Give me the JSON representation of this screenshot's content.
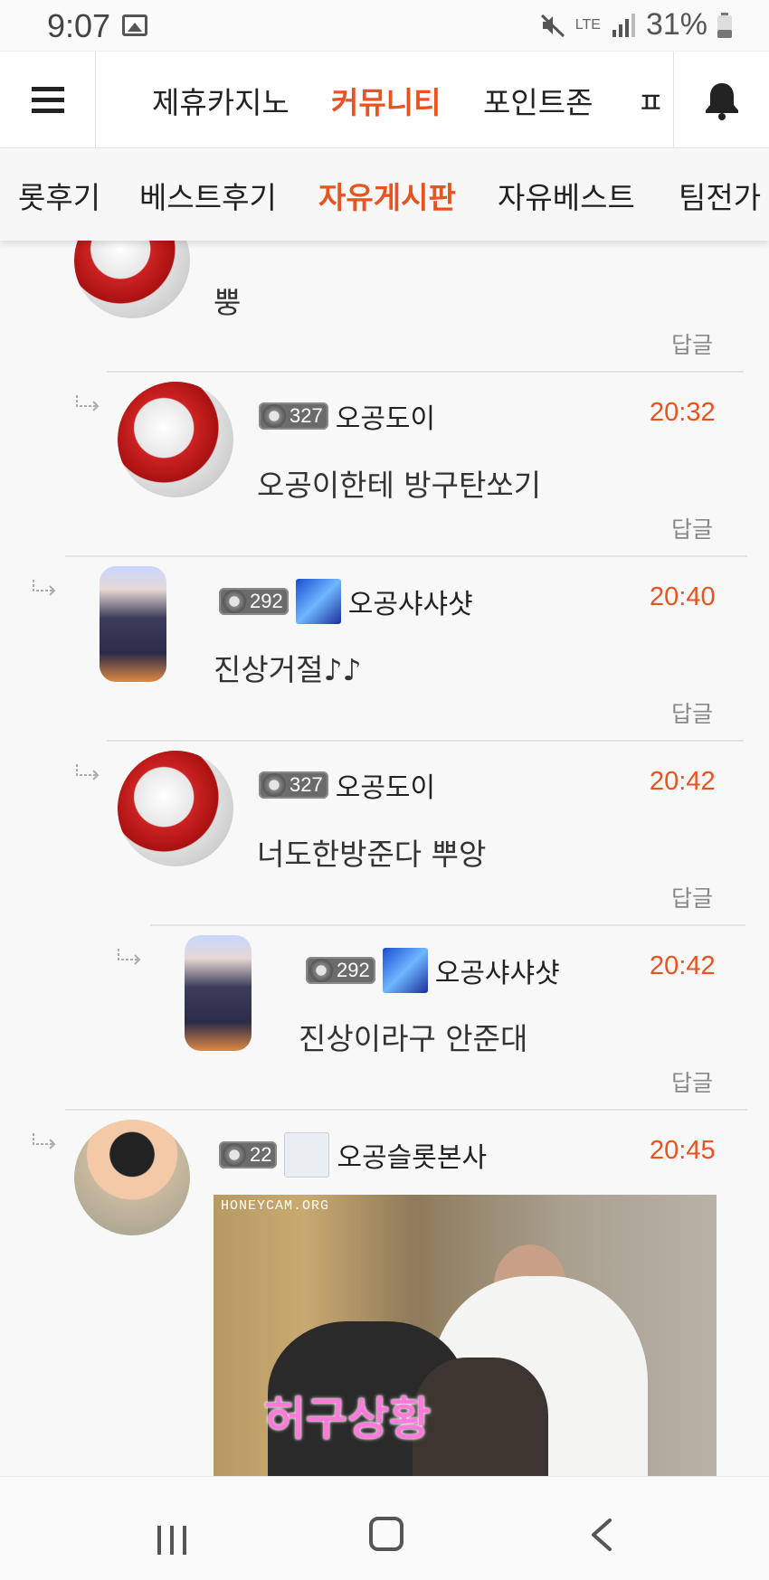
{
  "status_bar": {
    "time": "9:07",
    "network": "LTE",
    "battery_pct": "31%"
  },
  "main_nav": {
    "tabs": [
      {
        "label": "제휴카지노"
      },
      {
        "label": "커뮤니티"
      },
      {
        "label": "포인트존"
      },
      {
        "label": "ㅍ"
      }
    ],
    "active": "커뮤니티"
  },
  "sub_nav": {
    "tabs": [
      {
        "label": "롯후기"
      },
      {
        "label": "베스트후기"
      },
      {
        "label": "자유게시판"
      },
      {
        "label": "자유베스트"
      },
      {
        "label": "팀전가"
      }
    ],
    "active": "자유게시판"
  },
  "comments": [
    {
      "level": "",
      "nickname": "",
      "time": "",
      "text": "뿡",
      "reply": "답글"
    },
    {
      "level": "327",
      "nickname": "오공도이",
      "time": "20:32",
      "text": "오공이한테 방구탄쏘기",
      "reply": "답글"
    },
    {
      "level": "292",
      "nickname": "오공샤샤샷",
      "time": "20:40",
      "text": "진상거절♪♪",
      "reply": "답글"
    },
    {
      "level": "327",
      "nickname": "오공도이",
      "time": "20:42",
      "text": "너도한방준다 뿌앙",
      "reply": "답글"
    },
    {
      "level": "292",
      "nickname": "오공샤샤샷",
      "time": "20:42",
      "text": "진상이라구 안준대",
      "reply": "답글"
    },
    {
      "level": "22",
      "nickname": "오공슬롯본사",
      "time": "20:45",
      "text": "",
      "reply": ""
    }
  ],
  "gif": {
    "watermark": "HONEYCAM.ORG",
    "caption": "허구상황"
  },
  "colors": {
    "accent": "#e8531f",
    "text": "#222222",
    "muted": "#888888"
  }
}
